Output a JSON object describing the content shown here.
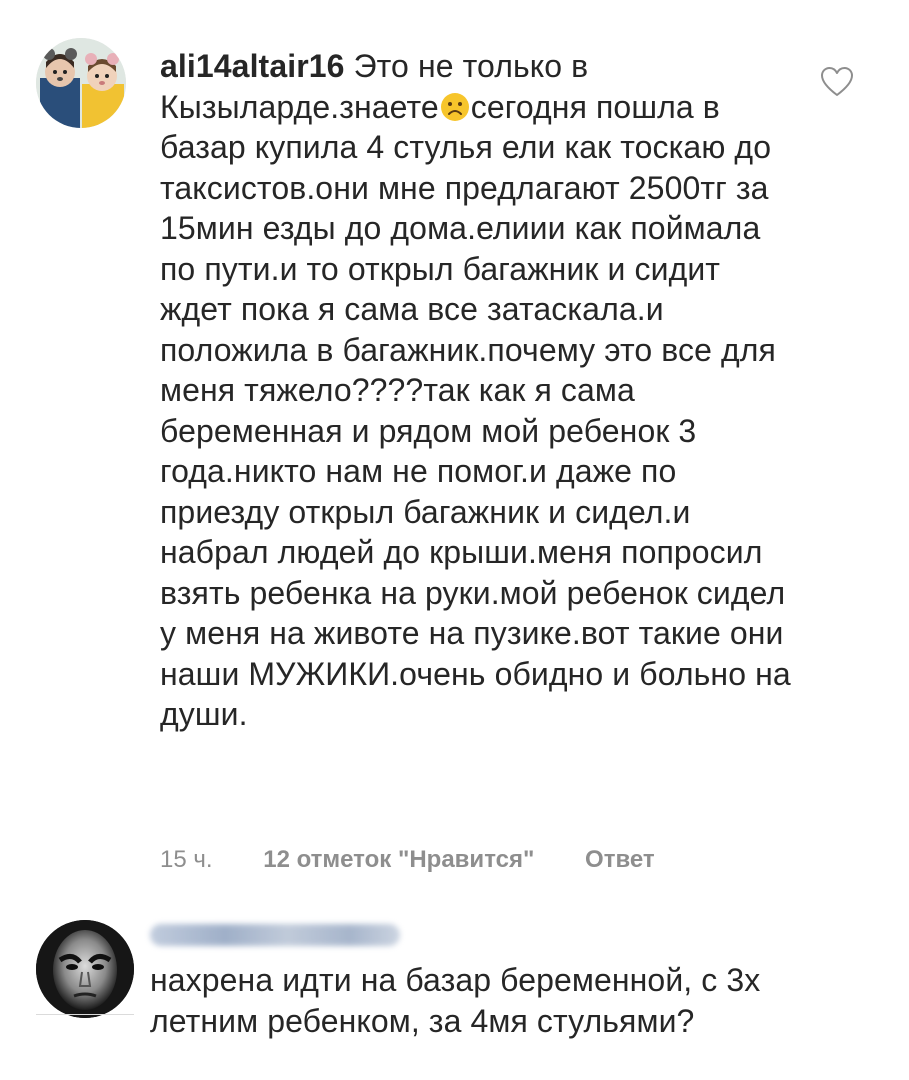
{
  "comments": [
    {
      "username": "ali14altair16",
      "text_before_emoji": "Это не только в Кызыларде.знаете",
      "emoji": "frowning-face",
      "text_after_emoji": "сегодня пошла в базар купила 4 стулья ели как тоскаю до таксистов.они мне предлагают 2500тг за 15мин езды до дома.елиии как поймала по пути.и то открыл багажник и сидит ждет пока я сама все затаскала.и положила в багажник.почему это все для меня тяжело????так как я сама беременная и рядом мой ребенок 3 года.никто нам не помог.и даже по приезду открыл багажник и сидел.и набрал людей до крыши.меня попросил взять ребенка на руки.мой ребенок сидел у меня на животе на пузике.вот такие они наши МУЖИКИ.очень обидно и больно на души.",
      "time": "15 ч.",
      "likes": "12 отметок \"Нравится\"",
      "reply": "Ответ",
      "like_icon": "heart-outline-icon"
    },
    {
      "username_hidden": true,
      "text": "нахрена идти на базар беременной, с 3х летним ребенком, за 4мя стульями?"
    }
  ],
  "colors": {
    "text": "#262626",
    "meta": "#8e8e8e",
    "divider": "#dbdbdb"
  }
}
